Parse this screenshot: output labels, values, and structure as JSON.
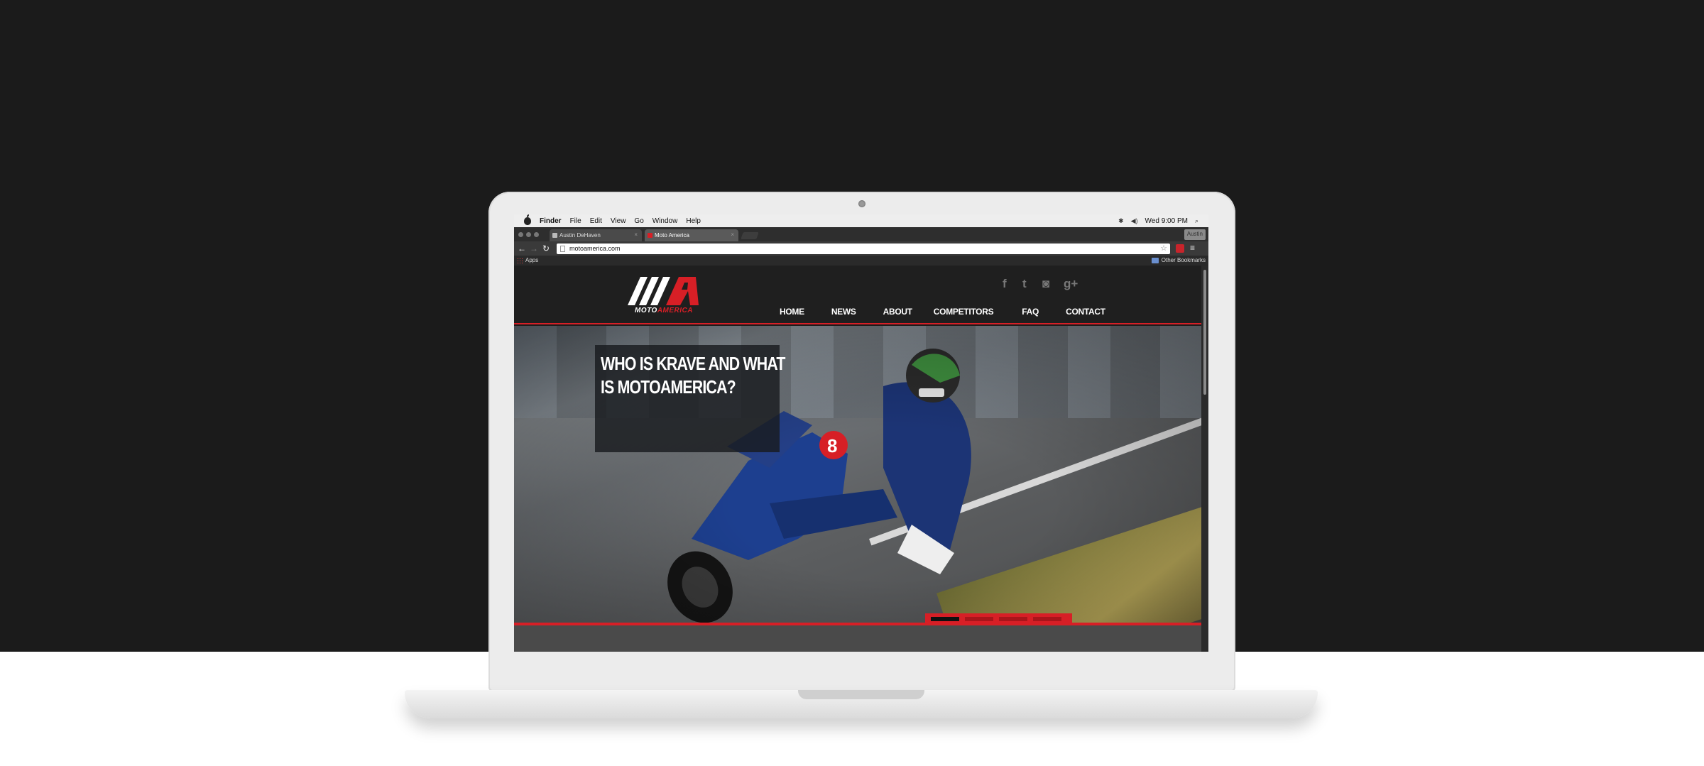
{
  "mac_menubar": {
    "items": [
      "Finder",
      "File",
      "Edit",
      "View",
      "Go",
      "Window",
      "Help"
    ],
    "clock": "Wed 9:00 PM"
  },
  "browser": {
    "tabs": [
      {
        "title": "Austin DeHaven"
      },
      {
        "title": "Moto America"
      }
    ],
    "profile": "Austin",
    "url": "motoamerica.com",
    "bookmarks": {
      "apps": "Apps",
      "other": "Other Bookmarks"
    }
  },
  "site": {
    "logo": {
      "part1": "MOTO",
      "part2": "AMERICA"
    },
    "social": [
      "f",
      "t",
      "◙",
      "g+"
    ],
    "nav": [
      "HOME",
      "NEWS",
      "ABOUT",
      "COMPETITORS",
      "FAQ",
      "CONTACT"
    ],
    "hero_title": "WHO IS KRAVE AND WHAT IS MOTOAMERICA?",
    "slider": {
      "count": 4,
      "active": 0
    }
  },
  "colors": {
    "accent": "#d71f26",
    "background": "#1b1b1b"
  }
}
